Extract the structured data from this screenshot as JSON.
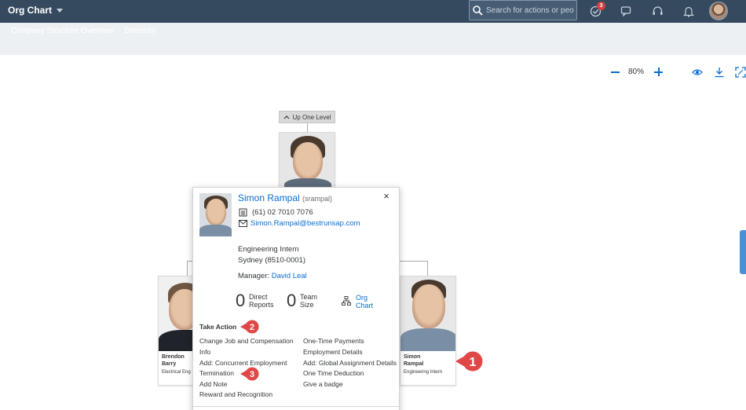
{
  "shell": {
    "title": "Org Chart",
    "search_placeholder": "Search for actions or peo...",
    "notification_count": "3",
    "icons": [
      "search-icon",
      "approvals-icon",
      "chat-icon",
      "support-icon",
      "bell-icon",
      "avatar"
    ]
  },
  "subnav": {
    "tabs": [
      "Company Structure Overview",
      "Directory"
    ]
  },
  "toolbar": {
    "zoom": "80%",
    "icons": [
      "zoom-out-icon",
      "zoom-in-icon",
      "eye-icon",
      "download-icon",
      "fullscreen-icon"
    ]
  },
  "chart": {
    "up_level_label": "Up One Level",
    "cards": {
      "left": {
        "first": "Brendon",
        "last": "Barry",
        "title": "Electrical Eng"
      },
      "right": {
        "first": "Simon",
        "last": "Rampal",
        "title": "Engineering Intern"
      }
    }
  },
  "popover": {
    "name": "Simon Rampal",
    "username": "(srampal)",
    "phone": "(61) 02 7010 7076",
    "email": "Simon.Rampal@bestrunsap.com",
    "job_title": "Engineering Intern",
    "location": "Sydney (8510-0001)",
    "manager_label": "Manager:",
    "manager_name": "David Leal",
    "direct_reports": {
      "count": "0",
      "label_1": "Direct",
      "label_2": "Reports"
    },
    "team_size": {
      "count": "0",
      "label_1": "Team",
      "label_2": "Size"
    },
    "org_chart_link": {
      "line_1": "Org",
      "line_2": "Chart"
    },
    "take_action_heading": "Take Action",
    "actions_left": [
      "Change Job and Compensation",
      "Info",
      "Add: Concurrent Employment",
      "Termination",
      "Add Note",
      "Reward and Recognition"
    ],
    "actions_right": [
      "One-Time Payments",
      "Employment Details",
      "Add: Global Assignment Details",
      "One Time Deduction",
      "Give a badge"
    ]
  },
  "callouts": [
    "1",
    "2",
    "3"
  ],
  "colors": {
    "shell_bg": "#354a5f",
    "link": "#0a6ed1",
    "callout": "#e04848"
  }
}
